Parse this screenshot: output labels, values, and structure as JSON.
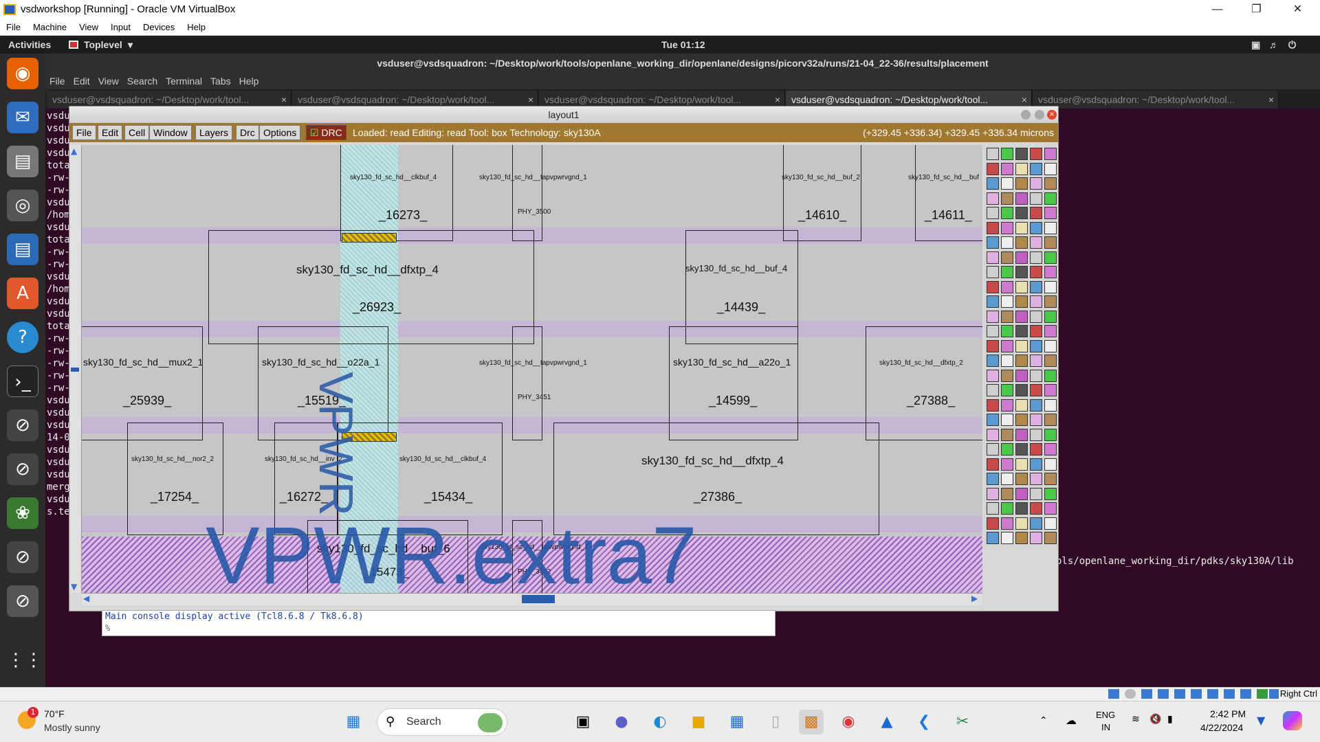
{
  "vbox": {
    "title": "vsdworkshop [Running] - Oracle VM VirtualBox",
    "menu": [
      "File",
      "Machine",
      "View",
      "Input",
      "Devices",
      "Help"
    ],
    "status_right": "Right Ctrl"
  },
  "topbar": {
    "activities": "Activities",
    "app": "Toplevel",
    "clock": "Tue 01:12"
  },
  "terminal": {
    "title": "vsduser@vsdsquadron: ~/Desktop/work/tools/openlane_working_dir/openlane/designs/picorv32a/runs/21-04_22-36/results/placement",
    "menu": [
      "File",
      "Edit",
      "View",
      "Search",
      "Terminal",
      "Tabs",
      "Help"
    ],
    "tabs": [
      "vsduser@vsdsquadron: ~/Desktop/work/tool...",
      "vsduser@vsdsquadron: ~/Desktop/work/tool...",
      "vsduser@vsdsquadron: ~/Desktop/work/tool...",
      "vsduser@vsdsquadron: ~/Desktop/work/tool...",
      "vsduser@vsdsquadron: ~/Desktop/work/tool..."
    ],
    "lines": [
      "vsdu",
      "vsdu",
      "vsdu",
      "vsdu",
      "tota",
      "-rw-",
      "-rw-",
      "vsdu",
      "/hom",
      "vsdu",
      "tota",
      "-rw-",
      "-rw-",
      "vsdu",
      "/hom",
      "vsdu",
      "vsdu",
      "tota",
      "-rw-",
      "-rw-",
      "-rw-",
      "-rw-",
      "-rw-",
      "vsdu",
      "vsdu",
      "vsdu",
      "14-0",
      "vsdu",
      "vsdu",
      "vsdu",
      "merg",
      "vsdu",
      "s.te"
    ],
    "path_fragment": "ols/openlane_working_dir/pdks/sky130A/lib"
  },
  "magic": {
    "window_title": "layout1",
    "menu": [
      "File",
      "Edit",
      "Cell",
      "Window",
      "Layers",
      "Drc",
      "Options"
    ],
    "drc": "DRC",
    "status": "Loaded: read Editing: read Tool: box  Technology: sky130A",
    "coords": "(+329.45 +336.34) +329.45 +336.34 microns",
    "overlay_big": "VPWR.extra7",
    "overlay_vert": "VPWR",
    "cells": [
      {
        "type": "sky130_fd_sc_hd__clkbuf_4",
        "id": "_16273_"
      },
      {
        "type": "sky130_fd_sc_hd__tapvpwrvgnd_1",
        "id": "PHY_3500"
      },
      {
        "type": "sky130_fd_sc_hd__buf_2",
        "id": "_14610_"
      },
      {
        "type": "sky130_fd_sc_hd__buf",
        "id": "_14611_"
      },
      {
        "type": "sky130_fd_sc_hd__dfxtp_4",
        "id": "_26923_"
      },
      {
        "type": "sky130_fd_sc_hd__buf_4",
        "id": "_14439_"
      },
      {
        "type": "sky130_fd_sc_hd__mux2_1",
        "id": "_25939_"
      },
      {
        "type": "sky130_fd_sc_hd__o22a_1",
        "id": "_15519_"
      },
      {
        "type": "sky130_fd_sc_hd__tapvpwrvgnd_1",
        "id": "PHY_3451"
      },
      {
        "type": "sky130_fd_sc_hd__a22o_1",
        "id": "_14599_"
      },
      {
        "type": "sky130_fd_sc_hd__dfxtp_2",
        "id": "_27388_"
      },
      {
        "type": "sky130_fd_sc_hd__nor2_2",
        "id": "_17254_"
      },
      {
        "type": "sky130_fd_sc_hd__inv_2",
        "id": "_16272_"
      },
      {
        "type": "sky130_fd_sc_hd__clkbuf_4",
        "id": "_15434_"
      },
      {
        "type": "sky130_fd_sc_hd__dfxtp_4",
        "id": "_27386_"
      },
      {
        "type": "sky130_fd_sc_hd__buf_6",
        "id": "_15473_"
      },
      {
        "type": "sky130_fd_sc_hd__tapvpwrvgnd_1",
        "id": "PHY_3402"
      }
    ],
    "console": [
      "Main console display active (Tcl8.6.8 / Tk8.6.8)",
      "%"
    ]
  },
  "taskbar": {
    "weather_temp": "70°F",
    "weather_desc": "Mostly sunny",
    "weather_badge": "1",
    "search": "Search",
    "lang1": "ENG",
    "lang2": "IN",
    "time": "2:42 PM",
    "date": "4/22/2024"
  },
  "colors": {
    "magic_bar": "#a07830",
    "rail": "#c6b6d6",
    "term_bg": "#300a24",
    "vpwr_text": "#2858a8"
  }
}
